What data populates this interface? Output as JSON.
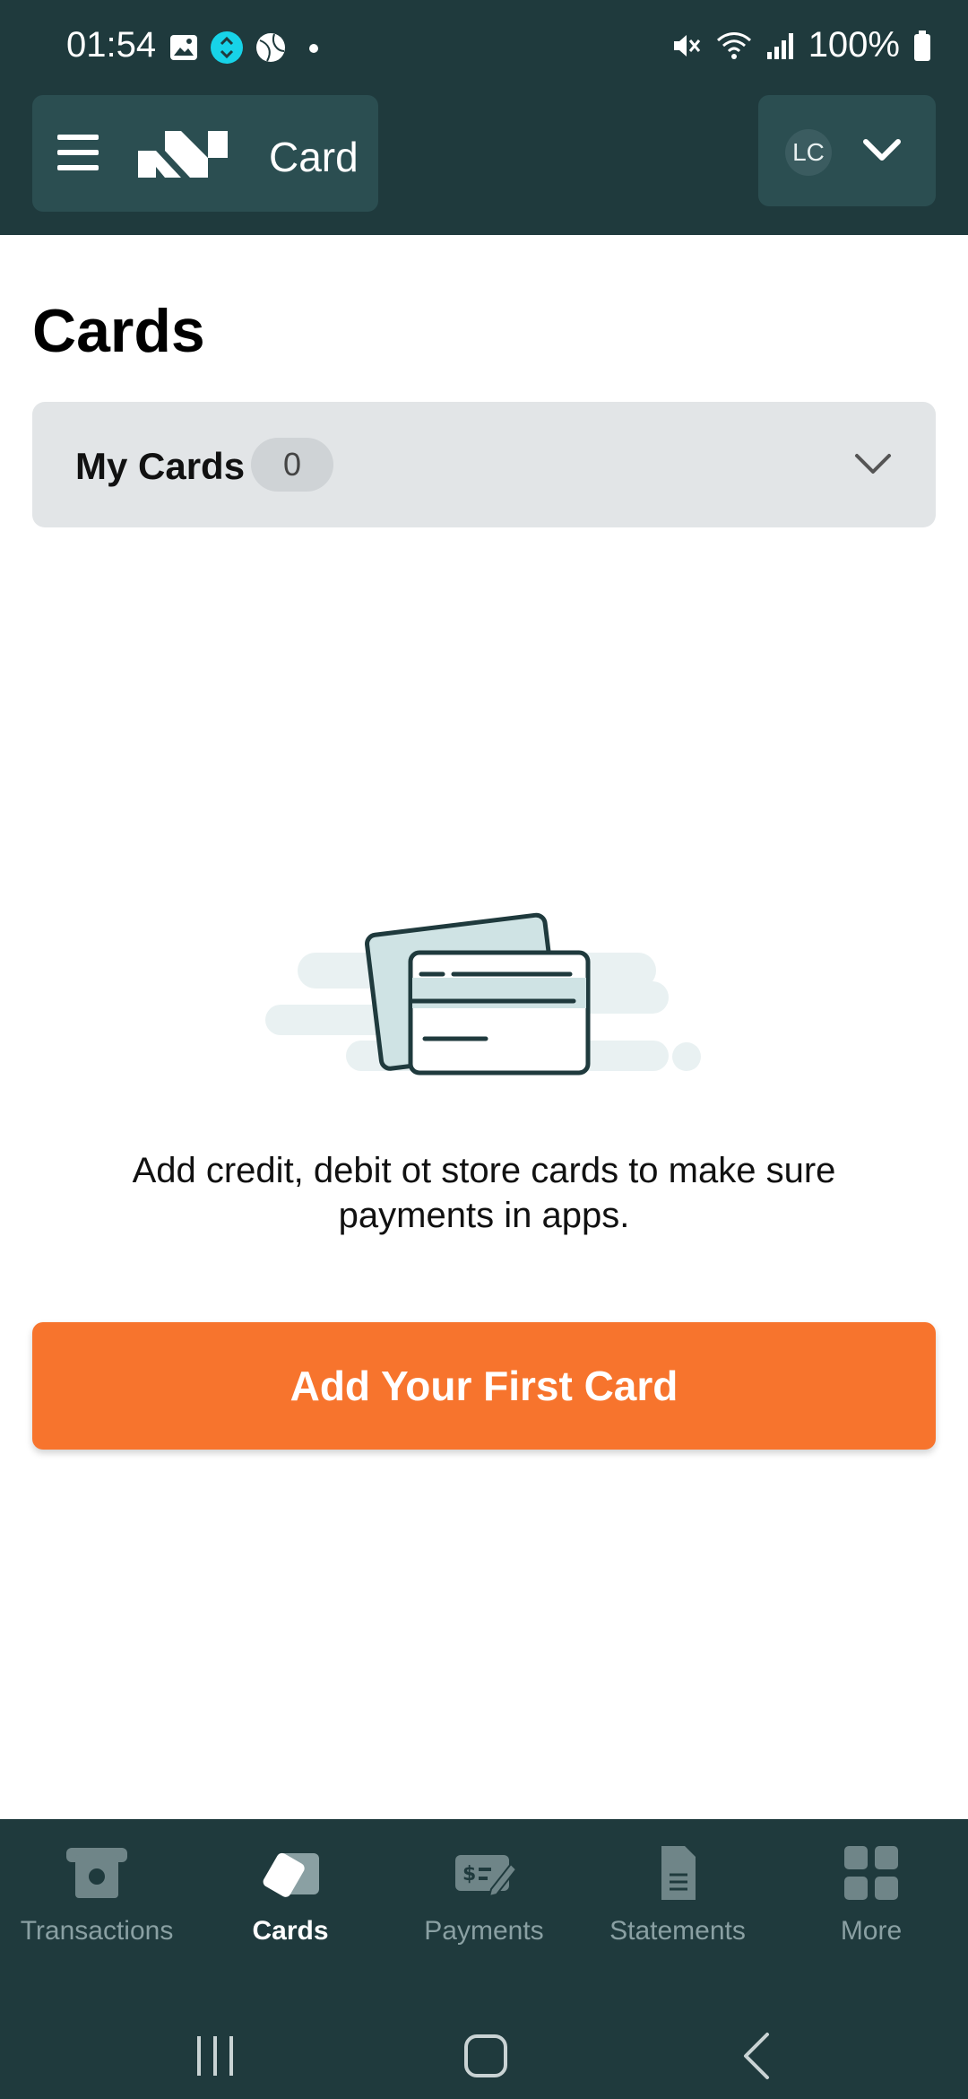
{
  "status_bar": {
    "time": "01:54",
    "battery": "100%"
  },
  "header": {
    "title": "Card",
    "avatar_initials": "LC"
  },
  "page": {
    "title": "Cards"
  },
  "my_cards": {
    "label": "My Cards",
    "count": "0"
  },
  "empty_state": {
    "message": "Add credit, debit ot store cards to make sure payments in apps.",
    "button_label": "Add Your First Card"
  },
  "bottom_nav": {
    "items": [
      {
        "label": "Transactions",
        "icon": "atm-icon",
        "active": false
      },
      {
        "label": "Cards",
        "icon": "card-icon",
        "active": true
      },
      {
        "label": "Payments",
        "icon": "check-payment-icon",
        "active": false
      },
      {
        "label": "Statements",
        "icon": "document-icon",
        "active": false
      },
      {
        "label": "More",
        "icon": "grid-icon",
        "active": false
      }
    ]
  },
  "colors": {
    "header_bg": "#1f3a3d",
    "accent": "#f7742d",
    "panel_bg": "#e2e5e7"
  }
}
